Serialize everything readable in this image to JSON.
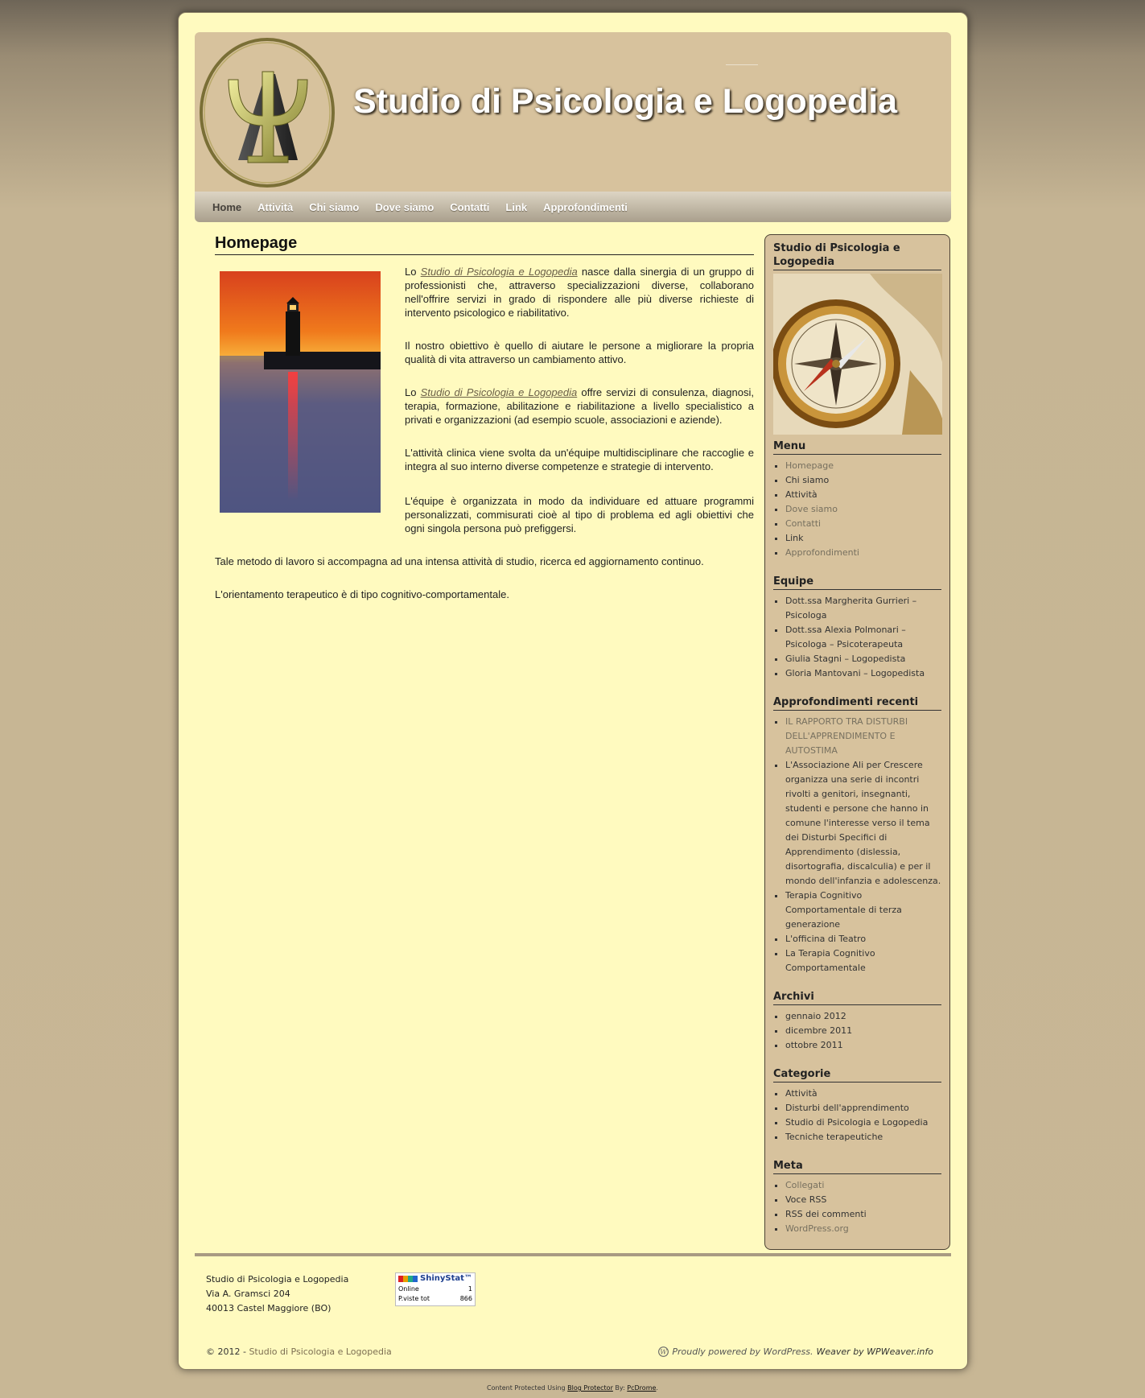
{
  "header": {
    "site_title": "Studio di Psicologia e Logopedia"
  },
  "nav": {
    "items": [
      {
        "label": "Home",
        "active": true
      },
      {
        "label": "Attività"
      },
      {
        "label": "Chi siamo"
      },
      {
        "label": "Dove siamo"
      },
      {
        "label": "Contatti"
      },
      {
        "label": "Link"
      },
      {
        "label": "Approfondimenti"
      }
    ]
  },
  "main": {
    "title": "Homepage",
    "p1": {
      "pre": "Lo ",
      "link": "Studio di Psicologia e Logopedia",
      "post": " nasce dalla sinergia di un gruppo di professionisti che, attraverso specializzazioni diverse, collaborano nell'offrire servizi in grado di rispondere alle più diverse richieste di intervento psicologico e riabilitativo."
    },
    "p2": "Il nostro obiettivo è quello di aiutare le persone a migliorare la propria qualità di vita attraverso un cambiamento attivo.",
    "p3": {
      "pre": "Lo ",
      "link": "Studio di Psicologia e Logopedia",
      "post": " offre servizi di consulenza, diagnosi, terapia, formazione, abilitazione e riabilitazione a livello specialistico a privati e organizzazioni (ad esempio scuole, associazioni e aziende)."
    },
    "p4": "L'attività clinica viene svolta da un'équipe multidisciplinare che raccoglie e integra al suo interno diverse competenze e strategie di intervento.",
    "p5": "L'équipe è organizzata in modo da individuare ed attuare programmi personalizzati, commisurati cioè al tipo di problema ed agli obiettivi che ogni singola persona può prefiggersi.",
    "p6": "Tale metodo di lavoro si accompagna ad una intensa attività di studio, ricerca ed aggiornamento continuo.",
    "p7": "L'orientamento terapeutico è di tipo cognitivo-comportamentale."
  },
  "sidebar": {
    "studio_title": "Studio di Psicologia e Logopedia",
    "menu": {
      "title": "Menu",
      "items": [
        "Homepage",
        "Chi siamo",
        "Attività",
        "Dove siamo",
        "Contatti",
        "Link",
        "Approfondimenti"
      ]
    },
    "equipe": {
      "title": "Equipe",
      "items": [
        "Dott.ssa Margherita Gurrieri – Psicologa",
        "Dott.ssa Alexia Polmonari – Psicologa – Psicoterapeuta",
        "Giulia Stagni – Logopedista",
        "Gloria Mantovani – Logopedista"
      ]
    },
    "recent": {
      "title": "Approfondimenti recenti",
      "items": [
        "IL RAPPORTO TRA DISTURBI DELL'APPRENDIMENTO E AUTOSTIMA",
        "L'Associazione Ali per Crescere organizza una serie di incontri rivolti a genitori, insegnanti, studenti e persone che hanno in comune l'interesse verso il tema dei Disturbi Specifici di Apprendimento (dislessia, disortografia, discalculia) e per il mondo dell'infanzia e adolescenza.",
        "Terapia Cognitivo Comportamentale di terza generazione",
        "L'officina di Teatro",
        "La Terapia Cognitivo Comportamentale"
      ]
    },
    "archive": {
      "title": "Archivi",
      "items": [
        "gennaio 2012",
        "dicembre 2011",
        "ottobre 2011"
      ]
    },
    "categories": {
      "title": "Categorie",
      "items": [
        "Attività",
        "Disturbi dell'apprendimento",
        "Studio di Psicologia e Logopedia",
        "Tecniche terapeutiche"
      ]
    },
    "meta": {
      "title": "Meta",
      "items": [
        "Collegati",
        "Voce RSS",
        "RSS dei commenti",
        "WordPress.org"
      ]
    }
  },
  "footer": {
    "address": [
      "Studio di Psicologia e Logopedia",
      "Via A. Gramsci 204",
      "40013 Castel Maggiore (BO)"
    ],
    "shinystat": {
      "brand": "ShinyStat™",
      "online_label": "Online",
      "online_value": "1",
      "views_label": "P.viste tot",
      "views_value": "866"
    },
    "copyright_prefix": "© 2012 - ",
    "copyright_site": "Studio di Psicologia e Logopedia",
    "powered": "Proudly powered by WordPress.",
    "weaver": "Weaver by WPWeaver.info",
    "protector": {
      "pre": "Content Protected Using ",
      "link1": "Blog Protector",
      "mid": " By: ",
      "link2": "PcDrome",
      "post": "."
    }
  }
}
